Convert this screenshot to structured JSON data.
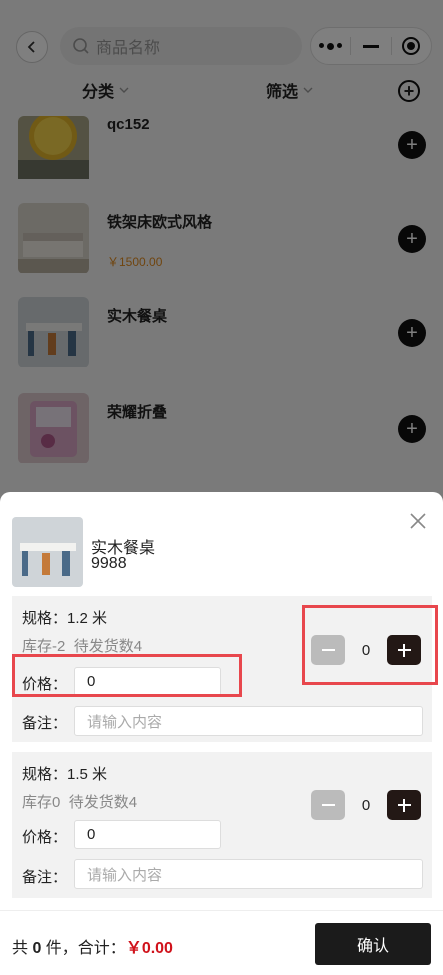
{
  "header": {
    "search_placeholder": "商品名称",
    "filters": [
      "分类",
      "筛选"
    ]
  },
  "products": [
    {
      "name": "qc152",
      "price": ""
    },
    {
      "name": "铁架床欧式风格",
      "price": "￥1500.00"
    },
    {
      "name": "实木餐桌",
      "price": ""
    },
    {
      "name": "荣耀折叠",
      "price": ""
    }
  ],
  "sheet": {
    "product_name": "实木餐桌",
    "product_code": "9988",
    "specs": [
      {
        "spec": "规格：1.2 米",
        "stock": "库存-2",
        "pending": "待发货数4",
        "price_label": "价格：",
        "price_value": "0",
        "note_label": "备注：",
        "note_placeholder": "请输入内容",
        "qty": "0"
      },
      {
        "spec": "规格：1.5 米",
        "stock": "库存0",
        "pending": "待发货数4",
        "price_label": "价格：",
        "price_value": "0",
        "note_label": "备注：",
        "note_placeholder": "请输入内容",
        "qty": "0"
      }
    ]
  },
  "footer": {
    "prefix": "共 ",
    "count": "0",
    "mid": " 件，合计：",
    "amount": "￥0.00",
    "confirm_label": "确认"
  },
  "colors": {
    "accent_dark": "#1b1b1b",
    "price_orange": "#e08a1e",
    "total_red": "#d0121b",
    "highlight_red": "#e8474d"
  }
}
